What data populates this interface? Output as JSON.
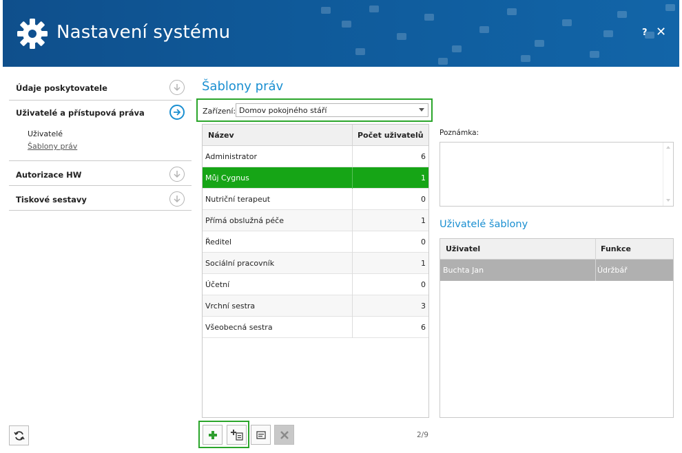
{
  "window": {
    "title": "Nastavení systému",
    "help_label": "?",
    "close_label": "✕"
  },
  "sidebar": {
    "sections": [
      {
        "label": "Údaje poskytovatele",
        "icon": "arrow-down-circle-icon",
        "active": false
      },
      {
        "label": "Uživatelé a přístupová práva",
        "icon": "arrow-right-circle-icon",
        "active": true
      },
      {
        "label": "Autorizace HW",
        "icon": "arrow-down-circle-icon",
        "active": false
      },
      {
        "label": "Tiskové sestavy",
        "icon": "arrow-down-circle-icon",
        "active": false
      }
    ],
    "subitems": [
      {
        "label": "Uživatelé"
      },
      {
        "label": "Šablony práv"
      }
    ]
  },
  "main": {
    "title": "Šablony práv",
    "device_label": "Zařízení:",
    "device_value": "Domov pokojného stáří",
    "columns": [
      "Název",
      "Počet uživatelů"
    ],
    "rows": [
      {
        "name": "Administrator",
        "count": "6"
      },
      {
        "name": "Můj Cygnus",
        "count": "1"
      },
      {
        "name": "Nutriční terapeut",
        "count": "0"
      },
      {
        "name": "Přímá obslužná péče",
        "count": "1"
      },
      {
        "name": "Ředitel",
        "count": "0"
      },
      {
        "name": "Sociální pracovník",
        "count": "1"
      },
      {
        "name": "Účetní",
        "count": "0"
      },
      {
        "name": "Vrchní sestra",
        "count": "3"
      },
      {
        "name": "Všeobecná sestra",
        "count": "6"
      }
    ],
    "selected_row": 1,
    "page_indicator": "2/9",
    "toolbar": [
      "add-icon",
      "add-copy-icon",
      "edit-icon",
      "delete-icon"
    ]
  },
  "right": {
    "note_label": "Poznámka:",
    "note_value": "",
    "users_title": "Uživatelé šablony",
    "columns": [
      "Uživatel",
      "Funkce"
    ],
    "rows": [
      {
        "user": "Buchta Jan",
        "role": "Údržbář"
      }
    ]
  },
  "colors": {
    "header_bg": "#0f5a9a",
    "accent": "#1a8fd1",
    "selection_green": "#16a516",
    "highlight_border": "#2aa52a"
  }
}
